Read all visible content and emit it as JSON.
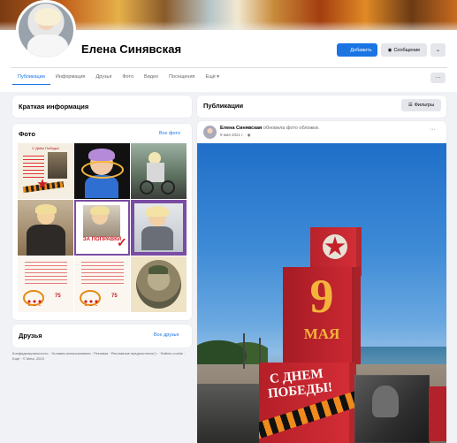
{
  "profile": {
    "name": "Елена Синявская",
    "buttons": {
      "add": "Добавить",
      "message": "Сообщение",
      "more": "⌄"
    }
  },
  "tabs": [
    {
      "label": "Публикации",
      "active": true
    },
    {
      "label": "Информация",
      "active": false
    },
    {
      "label": "Друзья",
      "active": false
    },
    {
      "label": "Фото",
      "active": false
    },
    {
      "label": "Видео",
      "active": false
    },
    {
      "label": "Посещения",
      "active": false
    },
    {
      "label": "Ещё ▾",
      "active": false
    }
  ],
  "tabs_more": "···",
  "intro": {
    "title": "Краткая информация"
  },
  "photos": {
    "title": "Фото",
    "link": "Все фото",
    "captions": {
      "p1": "С Днём Победы!",
      "p7_value": "75",
      "p8_value": "75",
      "p5_banner": "ЗА ПОПРАВКИ"
    }
  },
  "friends": {
    "title": "Друзья",
    "link": "Все друзья"
  },
  "footer": "Конфиденциальность · Условия использования · Реклама · Рекламные предпочтения ▷ · Файлы cookie · Ещё · © Meta, 2023",
  "publications": {
    "title": "Публикации",
    "filter_label": "Фильтры"
  },
  "post": {
    "author": "Елена Синявская",
    "action": "обновила фото обложки.",
    "date": "9 мая 2021 г. · ◉",
    "menu": "···",
    "monument": {
      "cube_number": "9",
      "cube_word": "МАЯ",
      "cube_phrase_1": "С ДНЕМ",
      "cube_phrase_2": "ПОБЕДЫ!"
    }
  },
  "colors": {
    "accent": "#1b74e4",
    "monument_red": "#c4202a",
    "gold": "#f4b43b"
  }
}
